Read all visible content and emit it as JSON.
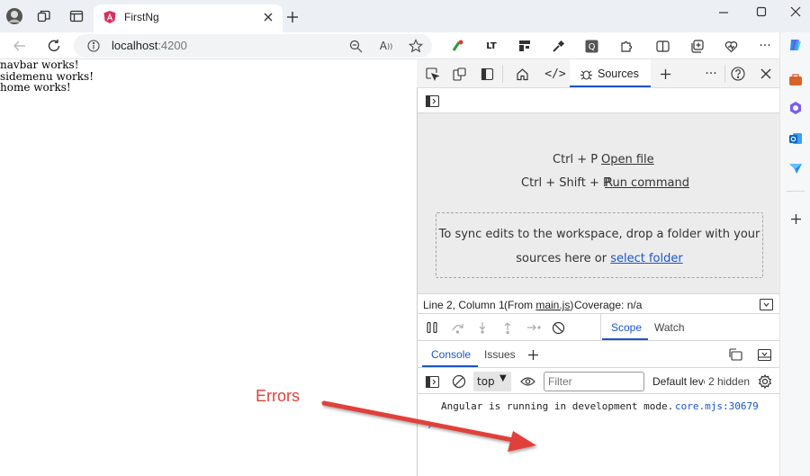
{
  "browser": {
    "tab_title": "FirstNg",
    "url_host": "localhost",
    "url_port": ":4200",
    "url_placeholder": "localhost:4200"
  },
  "page": {
    "lines": [
      "navbar works!",
      "sidemenu works!",
      "home works!"
    ]
  },
  "devtools": {
    "tabs": {
      "sources": "Sources"
    },
    "shortcuts": [
      {
        "keys": "Ctrl + P",
        "action": "Open file"
      },
      {
        "keys": "Ctrl + Shift + P",
        "action": "Run command"
      }
    ],
    "dropzone": {
      "line1": "To sync edits to the workspace, drop a folder with your",
      "line2_prefix": "sources here or ",
      "line2_link": "select folder"
    },
    "status": {
      "position": "Line 2, Column 1",
      "from_prefix": "(From ",
      "from_file": "main.js",
      "from_suffix": ")",
      "coverage": "Coverage: n/a"
    },
    "debug_tabs": {
      "scope": "Scope",
      "watch": "Watch"
    },
    "drawer_tabs": {
      "console": "Console",
      "issues": "Issues"
    },
    "console_toolbar": {
      "context": "top",
      "filter_placeholder": "Filter",
      "levels": "Default leve",
      "hidden": "2 hidden"
    },
    "console_messages": [
      {
        "text": "Angular is running in development mode.",
        "source": "core.mjs:30679"
      }
    ]
  },
  "annotation": {
    "label": "Errors",
    "color": "#e0413a"
  },
  "colors": {
    "accent": "#1a55c8",
    "angular_logo": "#d6305f"
  }
}
